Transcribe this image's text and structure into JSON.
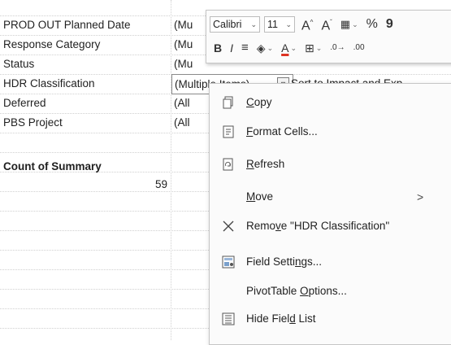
{
  "pivot": {
    "filters": [
      {
        "label": "PROD OUT Planned Date",
        "value": "(Mu"
      },
      {
        "label": "Response Category",
        "value": "(Mu"
      },
      {
        "label": "Status",
        "value": "(Mu"
      },
      {
        "label": "HDR Classification",
        "value": "(Multiple Items)"
      },
      {
        "label": "Deferred",
        "value": "(All"
      },
      {
        "label": "PBS Project",
        "value": "(All"
      }
    ],
    "hdr_trailing_text": "Sort to Impact and Exp",
    "clipped_text_right": "m",
    "values_header": "Count of Summary",
    "count_value": "59"
  },
  "mini_toolbar": {
    "font_name": "Calibri",
    "font_size": "11",
    "percent_symbol": "%",
    "comma_symbol": "9"
  },
  "context_menu": {
    "items": [
      {
        "pre": "",
        "key": "C",
        "post": "opy",
        "icon": "copy-icon"
      },
      {
        "pre": "",
        "key": "F",
        "post": "ormat Cells...",
        "icon": "format-cells-icon"
      },
      {
        "pre": "",
        "key": "R",
        "post": "efresh",
        "icon": "refresh-icon"
      },
      {
        "pre": "",
        "key": "M",
        "post": "ove",
        "icon": "",
        "submenu_arrow": ">"
      },
      {
        "pre": "Remo",
        "key": "v",
        "post": "e \"HDR Classification\"",
        "icon": "remove-x-icon"
      },
      {
        "pre": "Field Setti",
        "key": "n",
        "post": "gs...",
        "icon": "field-settings-icon"
      },
      {
        "pre": "PivotTable ",
        "key": "O",
        "post": "ptions...",
        "icon": ""
      },
      {
        "pre": "Hide Fiel",
        "key": "d",
        "post": " List",
        "icon": "field-list-icon"
      }
    ]
  }
}
